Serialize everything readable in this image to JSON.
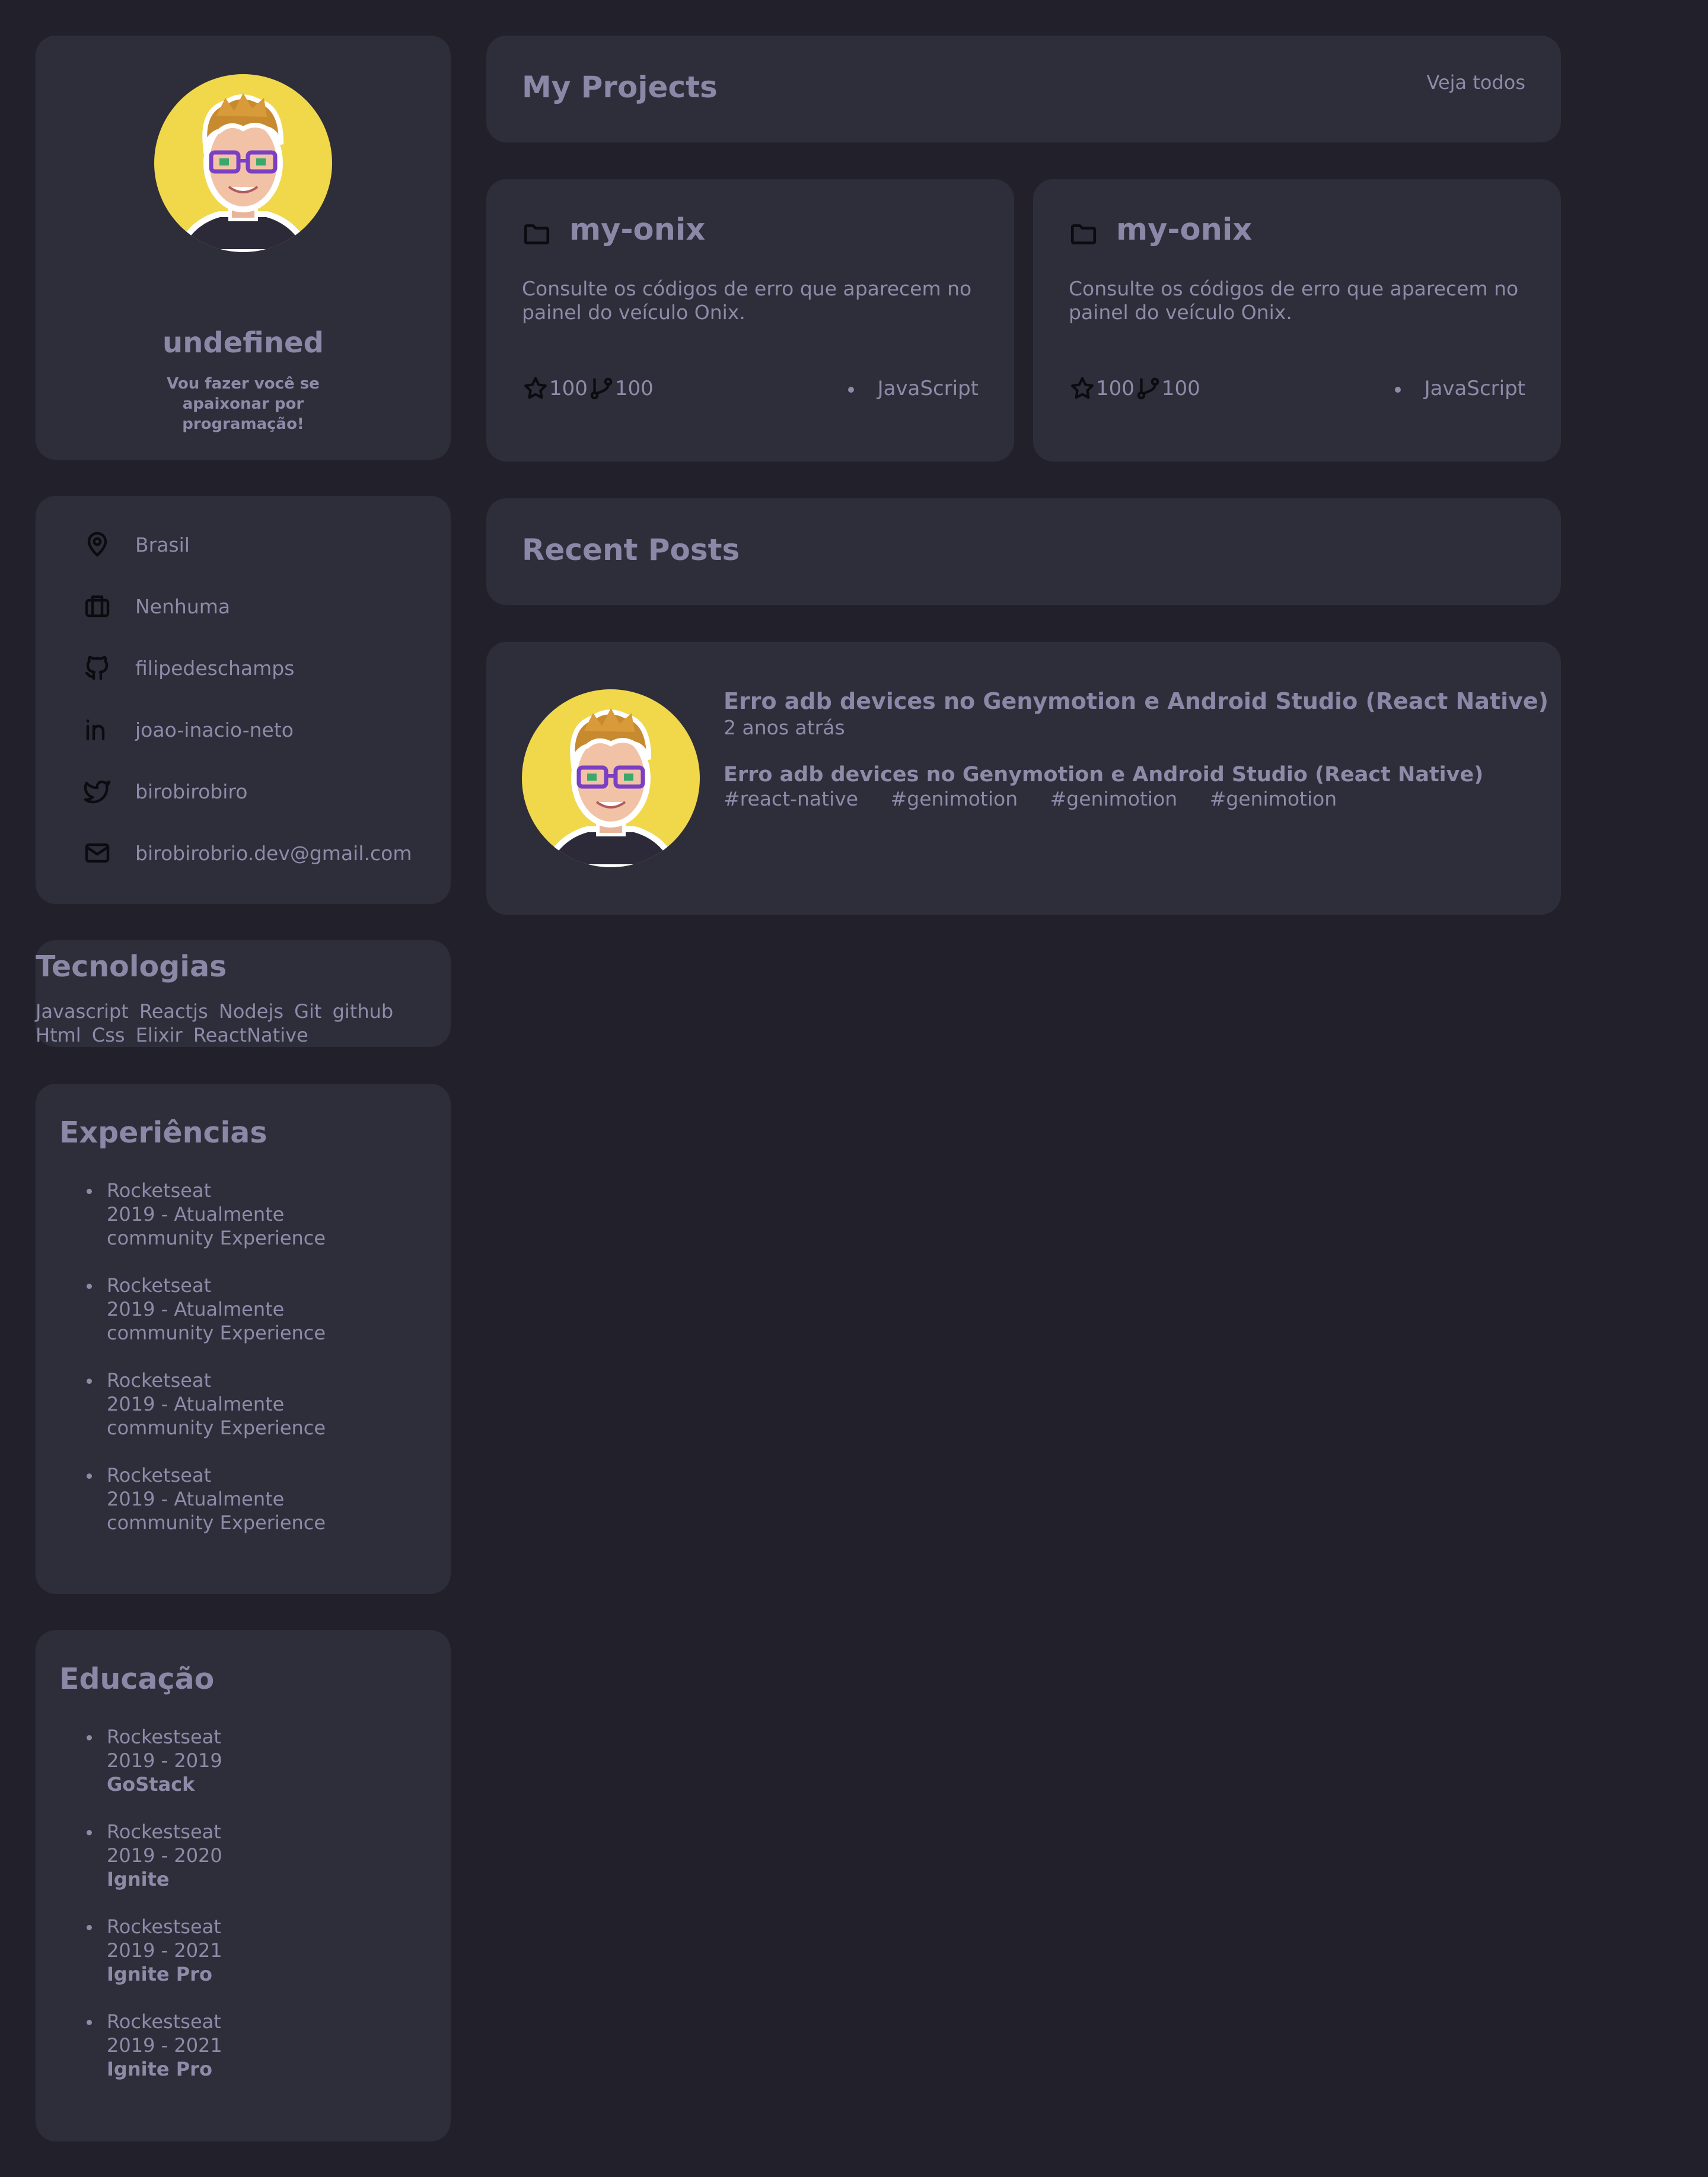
{
  "profile": {
    "name": "undefined",
    "bio": "Vou fazer você se apaixonar por programação!"
  },
  "contacts": [
    {
      "icon": "map-pin-icon",
      "label": "Brasil"
    },
    {
      "icon": "briefcase-icon",
      "label": "Nenhuma"
    },
    {
      "icon": "github-icon",
      "label": "filipedeschamps"
    },
    {
      "icon": "linkedin-icon",
      "label": "joao-inacio-neto"
    },
    {
      "icon": "twitter-icon",
      "label": "birobirobiro"
    },
    {
      "icon": "mail-icon",
      "label": "birobirobrio.dev@gmail.com"
    }
  ],
  "technologies": {
    "title": "Tecnologias",
    "items": [
      "Javascript",
      "Reactjs",
      "Nodejs",
      "Git",
      "github",
      "Html",
      "Css",
      "Elixir",
      "ReactNative"
    ]
  },
  "experiences": {
    "title": "Experiências",
    "items": [
      {
        "company": "Rocketseat",
        "period": "2019 - Atualmente",
        "role": "community Experience"
      },
      {
        "company": "Rocketseat",
        "period": "2019 - Atualmente",
        "role": "community Experience"
      },
      {
        "company": "Rocketseat",
        "period": "2019 - Atualmente",
        "role": "community Experience"
      },
      {
        "company": "Rocketseat",
        "period": "2019 - Atualmente",
        "role": "community Experience"
      }
    ]
  },
  "education": {
    "title": "Educação",
    "items": [
      {
        "school": "Rockestseat",
        "period": "2019 - 2019",
        "course": "GoStack"
      },
      {
        "school": "Rockestseat",
        "period": "2019 - 2020",
        "course": "Ignite"
      },
      {
        "school": "Rockestseat",
        "period": "2019 - 2021",
        "course": "Ignite Pro"
      },
      {
        "school": "Rockestseat",
        "period": "2019 - 2021",
        "course": "Ignite Pro"
      }
    ]
  },
  "projects": {
    "title": "My Projects",
    "see_all": "Veja todos",
    "items": [
      {
        "name": "my-onix",
        "description": "Consulte os códigos de erro que aparecem no painel do veículo Onix.",
        "stars": "100",
        "forks": "100",
        "language": "JavaScript"
      },
      {
        "name": "my-onix",
        "description": "Consulte os códigos de erro que aparecem no painel do veículo Onix.",
        "stars": "100",
        "forks": "100",
        "language": "JavaScript"
      }
    ]
  },
  "posts": {
    "title": "Recent Posts",
    "items": [
      {
        "title": "Erro adb devices no Genymotion e Android Studio (React Native)",
        "time": "2 anos atrás",
        "subtitle": "Erro adb devices no Genymotion e Android Studio (React Native)",
        "tags": [
          "#react-native",
          "#genimotion",
          "#genimotion",
          "#genimotion"
        ]
      }
    ]
  },
  "colors": {
    "background": "#22212b",
    "card": "#2e2d3a",
    "text": "#8e8aa8",
    "avatar_bg": "#f0d84a"
  }
}
